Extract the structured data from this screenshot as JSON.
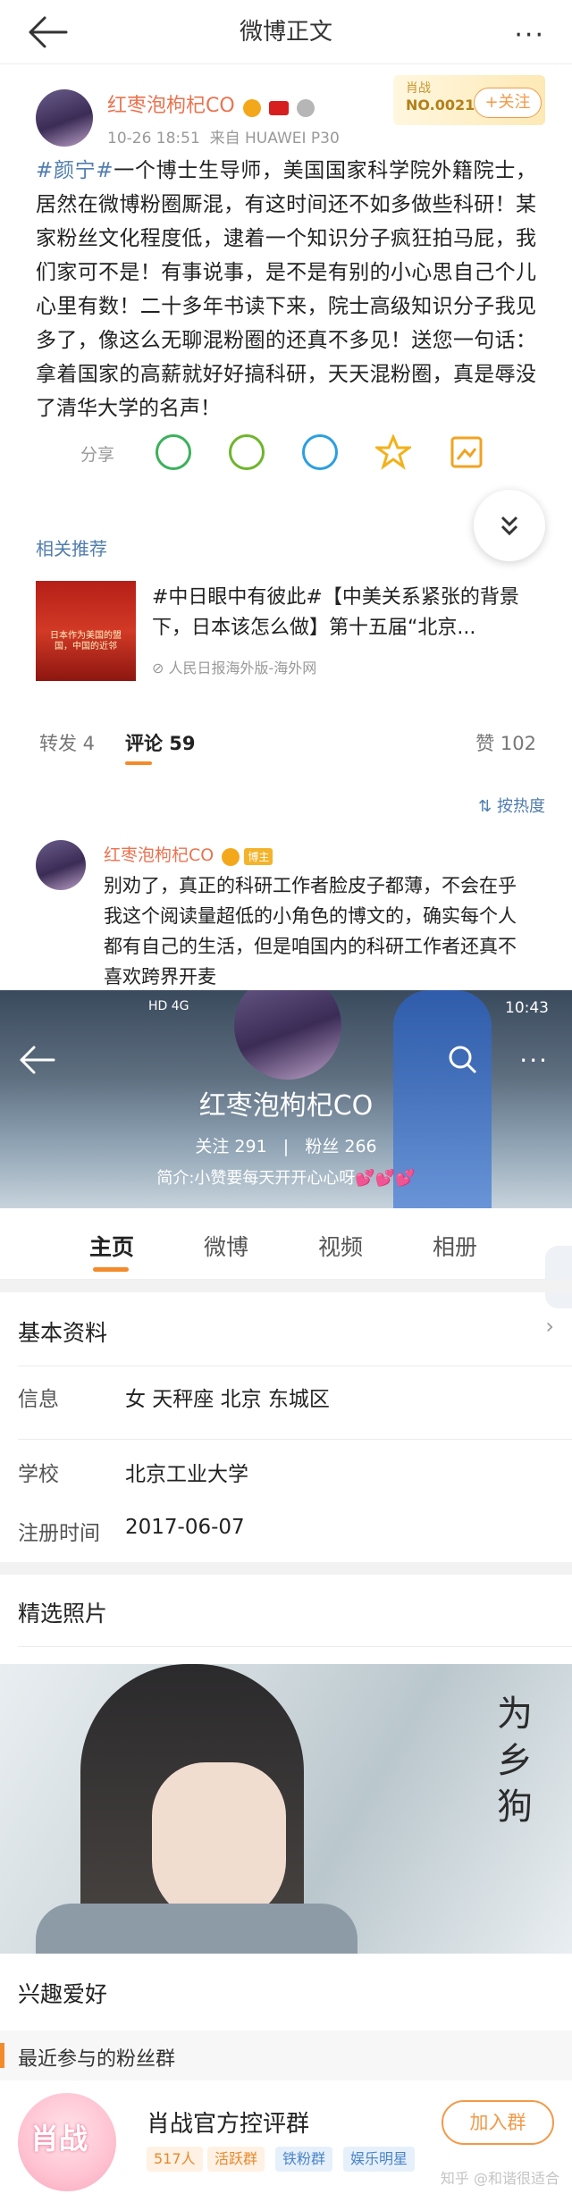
{
  "nav": {
    "title": "微博正文",
    "more": "···"
  },
  "post": {
    "author": "红枣泡枸杞CO",
    "time": "10-26 18:51",
    "source": "来自 HUAWEI P30",
    "card_label": "肖战",
    "card_number": "NO.002163",
    "follow_label": "+关注",
    "hashtag": "#颜宁#",
    "text": "一个博士生导师，美国国家科学院外籍院士，居然在微博粉圈厮混，有这时间还不如多做些科研！某家粉丝文化程度低，逮着一个知识分子疯狂拍马屁，我们家可不是！有事说事，是不是有别的小心思自己个儿心里有数！二十多年书读下来，院士高级知识分子我见多了，像这么无聊混粉圈的还真不多见！送您一句话：拿着国家的高薪就好好搞科研，天天混粉圈，真是辱没了清华大学的名声！",
    "share_label": "分享"
  },
  "share_icons": [
    {
      "name": "wechat-icon",
      "color": "#3bb15b"
    },
    {
      "name": "moments-icon",
      "color": "#6fb52c"
    },
    {
      "name": "qq-icon",
      "color": "#2c9fe0"
    },
    {
      "name": "qzone-icon",
      "color": "#f2b21d"
    },
    {
      "name": "save-image-icon",
      "color": "#f0a322"
    }
  ],
  "related": {
    "title": "相关推荐",
    "headline": "#中日眼中有彼此#【中美关系紧张的背景下，日本该怎么做】第十五届“北京...",
    "source": "人民日报海外版-海外网",
    "thumb_text": "日本作为美国的盟国，中国的近邻"
  },
  "tabs": {
    "repost": "转发 4",
    "comment": "评论 59",
    "like": "赞 102",
    "sort": "按热度"
  },
  "comment": {
    "author": "红枣泡枸杞CO",
    "level_badge": "博主",
    "text": "别劝了，真正的科研工作者脸皮子都薄，不会在乎我这个阅读量超低的小角色的博文的，确实每个人都有自己的生活，但是咱国内的科研工作者还真不喜欢跨界开麦"
  },
  "profile": {
    "status_time": "10:43",
    "status_left": "HD 4G",
    "name": "红枣泡枸杞CO",
    "stats_follow_label": "关注",
    "stats_follow": "291",
    "stats_fans_label": "粉丝",
    "stats_fans": "266",
    "bio": "简介:小赞要每天开开心心呀💕💕💕",
    "tabs": [
      "主页",
      "微博",
      "视频",
      "相册"
    ]
  },
  "basic_info": {
    "title": "基本资料",
    "rows": [
      {
        "label": "信息",
        "value": "女  天秤座  北京 东城区"
      },
      {
        "label": "学校",
        "value": "北京工业大学"
      },
      {
        "label": "注册时间",
        "value": "2017-06-07"
      }
    ]
  },
  "photos": {
    "title": "精选照片",
    "calligraphy": "为乡狗"
  },
  "hobby": {
    "title": "兴趣爱好"
  },
  "fans": {
    "section_title": "最近参与的粉丝群",
    "group_name": "肖战官方控评群",
    "avatar_text": "肖战",
    "chips": [
      {
        "label": "517人",
        "bg": "#fff1e3",
        "fg": "#e8892f"
      },
      {
        "label": "活跃群",
        "bg": "#fff1e3",
        "fg": "#e8892f"
      },
      {
        "label": "铁粉群",
        "bg": "#e6f0fb",
        "fg": "#4a84c9"
      },
      {
        "label": "娱乐明星",
        "bg": "#e6f0fb",
        "fg": "#4a84c9"
      }
    ],
    "join_label": "加入群",
    "watermark": "知乎 @和谐很适合"
  },
  "colors": {
    "accent": "#f38b2a",
    "link": "#507daf",
    "username": "#eb7350"
  }
}
